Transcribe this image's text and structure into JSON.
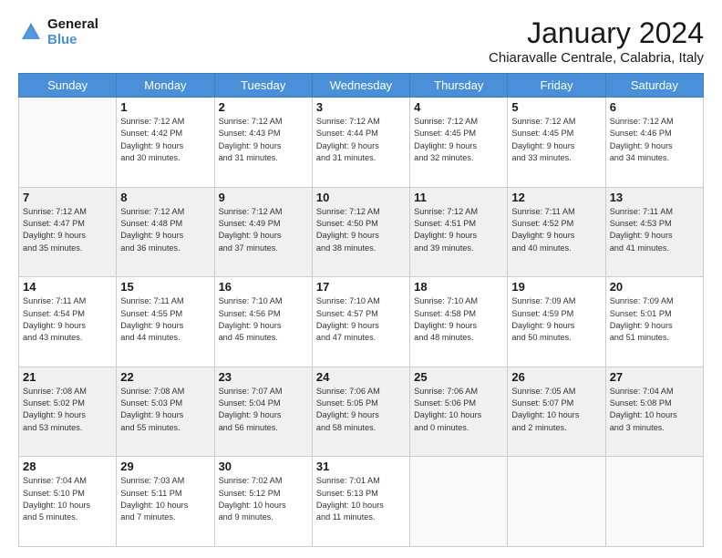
{
  "header": {
    "logo_line1": "General",
    "logo_line2": "Blue",
    "title": "January 2024",
    "subtitle": "Chiaravalle Centrale, Calabria, Italy"
  },
  "days_of_week": [
    "Sunday",
    "Monday",
    "Tuesday",
    "Wednesday",
    "Thursday",
    "Friday",
    "Saturday"
  ],
  "weeks": [
    {
      "shaded": false,
      "days": [
        {
          "num": "",
          "info": ""
        },
        {
          "num": "1",
          "info": "Sunrise: 7:12 AM\nSunset: 4:42 PM\nDaylight: 9 hours\nand 30 minutes."
        },
        {
          "num": "2",
          "info": "Sunrise: 7:12 AM\nSunset: 4:43 PM\nDaylight: 9 hours\nand 31 minutes."
        },
        {
          "num": "3",
          "info": "Sunrise: 7:12 AM\nSunset: 4:44 PM\nDaylight: 9 hours\nand 31 minutes."
        },
        {
          "num": "4",
          "info": "Sunrise: 7:12 AM\nSunset: 4:45 PM\nDaylight: 9 hours\nand 32 minutes."
        },
        {
          "num": "5",
          "info": "Sunrise: 7:12 AM\nSunset: 4:45 PM\nDaylight: 9 hours\nand 33 minutes."
        },
        {
          "num": "6",
          "info": "Sunrise: 7:12 AM\nSunset: 4:46 PM\nDaylight: 9 hours\nand 34 minutes."
        }
      ]
    },
    {
      "shaded": true,
      "days": [
        {
          "num": "7",
          "info": "Sunrise: 7:12 AM\nSunset: 4:47 PM\nDaylight: 9 hours\nand 35 minutes."
        },
        {
          "num": "8",
          "info": "Sunrise: 7:12 AM\nSunset: 4:48 PM\nDaylight: 9 hours\nand 36 minutes."
        },
        {
          "num": "9",
          "info": "Sunrise: 7:12 AM\nSunset: 4:49 PM\nDaylight: 9 hours\nand 37 minutes."
        },
        {
          "num": "10",
          "info": "Sunrise: 7:12 AM\nSunset: 4:50 PM\nDaylight: 9 hours\nand 38 minutes."
        },
        {
          "num": "11",
          "info": "Sunrise: 7:12 AM\nSunset: 4:51 PM\nDaylight: 9 hours\nand 39 minutes."
        },
        {
          "num": "12",
          "info": "Sunrise: 7:11 AM\nSunset: 4:52 PM\nDaylight: 9 hours\nand 40 minutes."
        },
        {
          "num": "13",
          "info": "Sunrise: 7:11 AM\nSunset: 4:53 PM\nDaylight: 9 hours\nand 41 minutes."
        }
      ]
    },
    {
      "shaded": false,
      "days": [
        {
          "num": "14",
          "info": "Sunrise: 7:11 AM\nSunset: 4:54 PM\nDaylight: 9 hours\nand 43 minutes."
        },
        {
          "num": "15",
          "info": "Sunrise: 7:11 AM\nSunset: 4:55 PM\nDaylight: 9 hours\nand 44 minutes."
        },
        {
          "num": "16",
          "info": "Sunrise: 7:10 AM\nSunset: 4:56 PM\nDaylight: 9 hours\nand 45 minutes."
        },
        {
          "num": "17",
          "info": "Sunrise: 7:10 AM\nSunset: 4:57 PM\nDaylight: 9 hours\nand 47 minutes."
        },
        {
          "num": "18",
          "info": "Sunrise: 7:10 AM\nSunset: 4:58 PM\nDaylight: 9 hours\nand 48 minutes."
        },
        {
          "num": "19",
          "info": "Sunrise: 7:09 AM\nSunset: 4:59 PM\nDaylight: 9 hours\nand 50 minutes."
        },
        {
          "num": "20",
          "info": "Sunrise: 7:09 AM\nSunset: 5:01 PM\nDaylight: 9 hours\nand 51 minutes."
        }
      ]
    },
    {
      "shaded": true,
      "days": [
        {
          "num": "21",
          "info": "Sunrise: 7:08 AM\nSunset: 5:02 PM\nDaylight: 9 hours\nand 53 minutes."
        },
        {
          "num": "22",
          "info": "Sunrise: 7:08 AM\nSunset: 5:03 PM\nDaylight: 9 hours\nand 55 minutes."
        },
        {
          "num": "23",
          "info": "Sunrise: 7:07 AM\nSunset: 5:04 PM\nDaylight: 9 hours\nand 56 minutes."
        },
        {
          "num": "24",
          "info": "Sunrise: 7:06 AM\nSunset: 5:05 PM\nDaylight: 9 hours\nand 58 minutes."
        },
        {
          "num": "25",
          "info": "Sunrise: 7:06 AM\nSunset: 5:06 PM\nDaylight: 10 hours\nand 0 minutes."
        },
        {
          "num": "26",
          "info": "Sunrise: 7:05 AM\nSunset: 5:07 PM\nDaylight: 10 hours\nand 2 minutes."
        },
        {
          "num": "27",
          "info": "Sunrise: 7:04 AM\nSunset: 5:08 PM\nDaylight: 10 hours\nand 3 minutes."
        }
      ]
    },
    {
      "shaded": false,
      "days": [
        {
          "num": "28",
          "info": "Sunrise: 7:04 AM\nSunset: 5:10 PM\nDaylight: 10 hours\nand 5 minutes."
        },
        {
          "num": "29",
          "info": "Sunrise: 7:03 AM\nSunset: 5:11 PM\nDaylight: 10 hours\nand 7 minutes."
        },
        {
          "num": "30",
          "info": "Sunrise: 7:02 AM\nSunset: 5:12 PM\nDaylight: 10 hours\nand 9 minutes."
        },
        {
          "num": "31",
          "info": "Sunrise: 7:01 AM\nSunset: 5:13 PM\nDaylight: 10 hours\nand 11 minutes."
        },
        {
          "num": "",
          "info": ""
        },
        {
          "num": "",
          "info": ""
        },
        {
          "num": "",
          "info": ""
        }
      ]
    }
  ]
}
